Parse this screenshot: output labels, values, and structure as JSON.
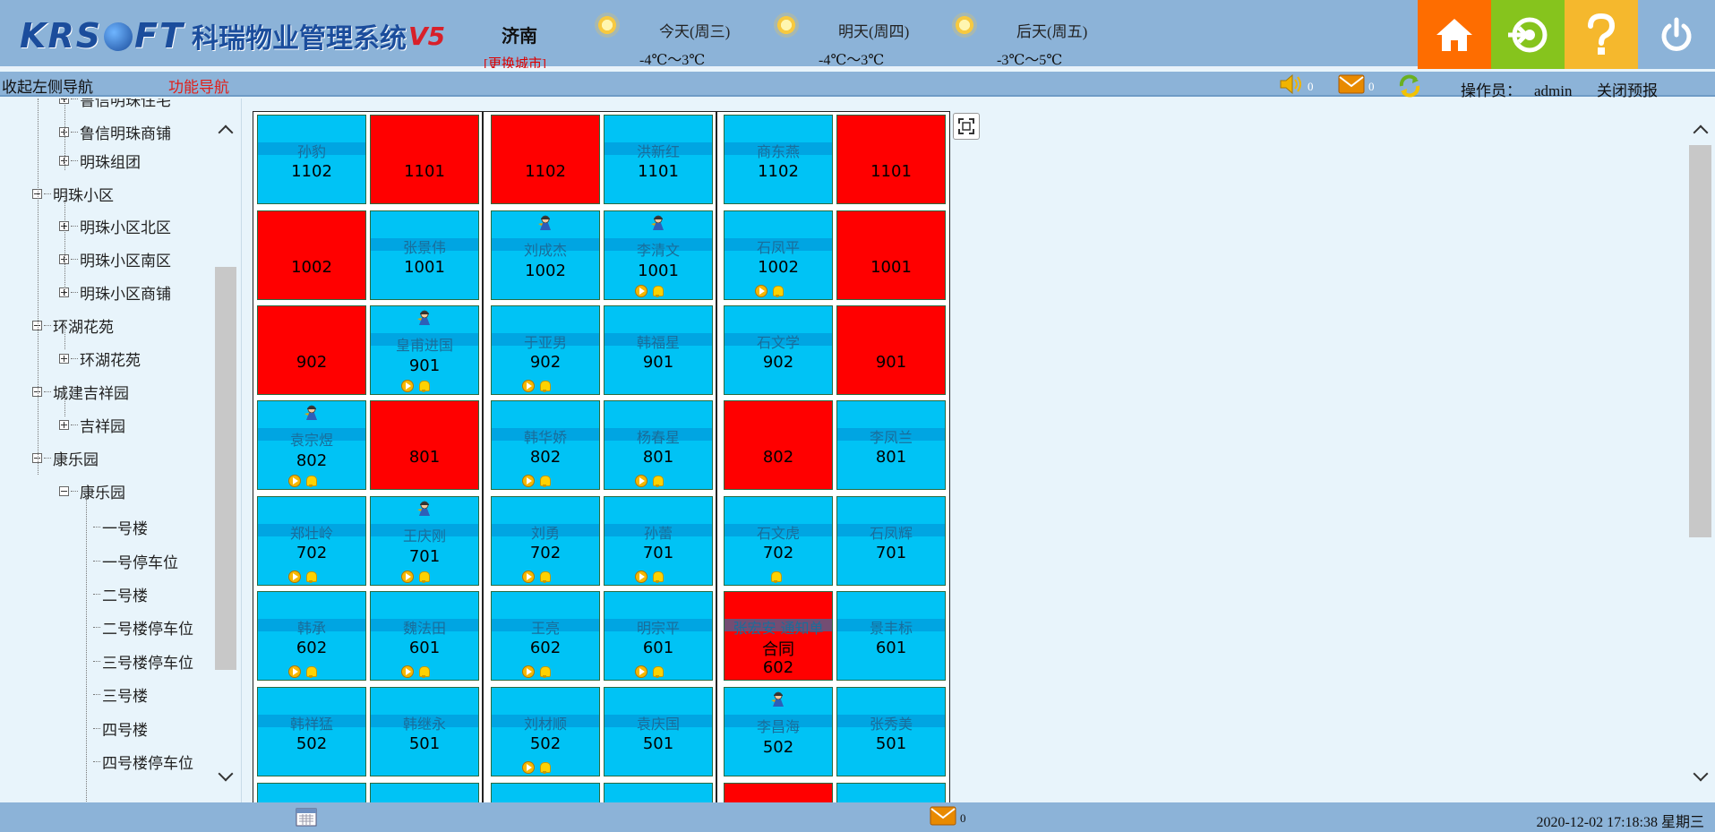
{
  "header": {
    "logo_brand_left": "KRS",
    "logo_brand_right": "FT",
    "system_name": "科瑞物业管理系统",
    "version": "V5",
    "city": "济南",
    "city_change": "[更换城市]",
    "weather": [
      {
        "day": "今天(周三)",
        "temp": "-4℃～3℃",
        "icon": "sunny-icon"
      },
      {
        "day": "明天(周四)",
        "temp": "-4℃～3℃",
        "icon": "sunny-icon"
      },
      {
        "day": "后天(周五)",
        "temp": "-3℃～5℃",
        "icon": "sunny-icon"
      }
    ],
    "buttons": {
      "home": {
        "icon": "home-icon",
        "color": "#fe6d00"
      },
      "refresh": {
        "icon": "login-icon",
        "color": "#86c41d"
      },
      "help": {
        "icon": "help-icon",
        "color": "#f5b82d"
      },
      "power": {
        "icon": "power-icon"
      }
    }
  },
  "navbar": {
    "collapse_label": "收起左侧导航",
    "function_nav_label": "功能导航",
    "sound_count": "0",
    "message_count": "0",
    "operator_label": "操作员：",
    "operator_name": "admin",
    "close_alert_label": "关闭预报"
  },
  "tree": [
    {
      "label": "鲁信明珠住宅",
      "level": 2,
      "toggle": "plus"
    },
    {
      "label": "鲁信明珠商铺",
      "level": 2,
      "toggle": "plus"
    },
    {
      "label": "明珠组团",
      "level": 2,
      "toggle": "plus"
    },
    {
      "label": "明珠小区",
      "level": 1,
      "toggle": "minus"
    },
    {
      "label": "明珠小区北区",
      "level": 2,
      "toggle": "plus"
    },
    {
      "label": "明珠小区南区",
      "level": 2,
      "toggle": "plus"
    },
    {
      "label": "明珠小区商铺",
      "level": 2,
      "toggle": "plus"
    },
    {
      "label": "环湖花苑",
      "level": 1,
      "toggle": "minus"
    },
    {
      "label": "环湖花苑",
      "level": 2,
      "toggle": "plus"
    },
    {
      "label": "城建吉祥园",
      "level": 1,
      "toggle": "minus"
    },
    {
      "label": "吉祥园",
      "level": 2,
      "toggle": "plus"
    },
    {
      "label": "康乐园",
      "level": 1,
      "toggle": "minus"
    },
    {
      "label": "康乐园",
      "level": 2,
      "toggle": "minus"
    },
    {
      "label": "一号楼",
      "level": 3,
      "toggle": "none"
    },
    {
      "label": "一号停车位",
      "level": 3,
      "toggle": "none"
    },
    {
      "label": "二号楼",
      "level": 3,
      "toggle": "none"
    },
    {
      "label": "二号楼停车位",
      "level": 3,
      "toggle": "none"
    },
    {
      "label": "三号楼停车位",
      "level": 3,
      "toggle": "none"
    },
    {
      "label": "三号楼",
      "level": 3,
      "toggle": "none"
    },
    {
      "label": "四号楼",
      "level": 3,
      "toggle": "none"
    },
    {
      "label": "四号楼停车位",
      "level": 3,
      "toggle": "none"
    }
  ],
  "rooms": [
    [
      {
        "owner": "孙豹",
        "num": "1102",
        "status": "occupied",
        "figure": false,
        "icons": ""
      },
      {
        "owner": "",
        "num": "1101",
        "status": "vacant",
        "figure": false,
        "icons": ""
      },
      {
        "owner": "",
        "num": "1102",
        "status": "vacant",
        "figure": false,
        "icons": ""
      },
      {
        "owner": "洪新红",
        "num": "1101",
        "status": "occupied",
        "figure": false,
        "icons": ""
      },
      {
        "owner": "商东燕",
        "num": "1102",
        "status": "occupied",
        "figure": false,
        "icons": ""
      },
      {
        "owner": "",
        "num": "1101",
        "status": "vacant",
        "figure": false,
        "icons": ""
      }
    ],
    [
      {
        "owner": "",
        "num": "1002",
        "status": "vacant",
        "figure": false,
        "icons": ""
      },
      {
        "owner": "张景伟",
        "num": "1001",
        "status": "occupied",
        "figure": false,
        "icons": ""
      },
      {
        "owner": "刘成杰",
        "num": "1002",
        "status": "occupied",
        "figure": true,
        "icons": ""
      },
      {
        "owner": "李清文",
        "num": "1001",
        "status": "occupied",
        "figure": true,
        "icons": "pb"
      },
      {
        "owner": "石凤平",
        "num": "1002",
        "status": "occupied",
        "figure": false,
        "icons": "pb"
      },
      {
        "owner": "",
        "num": "1001",
        "status": "vacant",
        "figure": false,
        "icons": ""
      }
    ],
    [
      {
        "owner": "",
        "num": "902",
        "status": "vacant",
        "figure": false,
        "icons": ""
      },
      {
        "owner": "皇甫进国",
        "num": "901",
        "status": "occupied",
        "figure": true,
        "icons": "pb"
      },
      {
        "owner": "于亚男",
        "num": "902",
        "status": "occupied",
        "figure": false,
        "icons": "pb"
      },
      {
        "owner": "韩福星",
        "num": "901",
        "status": "occupied",
        "figure": false,
        "icons": ""
      },
      {
        "owner": "石文学",
        "num": "902",
        "status": "occupied",
        "figure": false,
        "icons": ""
      },
      {
        "owner": "",
        "num": "901",
        "status": "vacant",
        "figure": false,
        "icons": ""
      }
    ],
    [
      {
        "owner": "袁宗煜",
        "num": "802",
        "status": "occupied",
        "figure": true,
        "icons": "pb"
      },
      {
        "owner": "",
        "num": "801",
        "status": "vacant",
        "figure": false,
        "icons": ""
      },
      {
        "owner": "韩华娇",
        "num": "802",
        "status": "occupied",
        "figure": false,
        "icons": "pb"
      },
      {
        "owner": "杨春星",
        "num": "801",
        "status": "occupied",
        "figure": false,
        "icons": "pb"
      },
      {
        "owner": "",
        "num": "802",
        "status": "vacant",
        "figure": false,
        "icons": ""
      },
      {
        "owner": "李凤兰",
        "num": "801",
        "status": "occupied",
        "figure": false,
        "icons": ""
      }
    ],
    [
      {
        "owner": "郑壮岭",
        "num": "702",
        "status": "occupied",
        "figure": false,
        "icons": "pb"
      },
      {
        "owner": "王庆刚",
        "num": "701",
        "status": "occupied",
        "figure": true,
        "icons": "pb"
      },
      {
        "owner": "刘勇",
        "num": "702",
        "status": "occupied",
        "figure": false,
        "icons": "pb"
      },
      {
        "owner": "孙蕾",
        "num": "701",
        "status": "occupied",
        "figure": false,
        "icons": "pb"
      },
      {
        "owner": "石文虎",
        "num": "702",
        "status": "occupied",
        "figure": false,
        "icons": "b"
      },
      {
        "owner": "石凤辉",
        "num": "701",
        "status": "occupied",
        "figure": false,
        "icons": ""
      }
    ],
    [
      {
        "owner": "韩承",
        "num": "602",
        "status": "occupied",
        "figure": false,
        "icons": "pb"
      },
      {
        "owner": "魏法田",
        "num": "601",
        "status": "occupied",
        "figure": false,
        "icons": "pb"
      },
      {
        "owner": "王亮",
        "num": "602",
        "status": "occupied",
        "figure": false,
        "icons": "pb"
      },
      {
        "owner": "明宗平",
        "num": "601",
        "status": "occupied",
        "figure": false,
        "icons": "pb"
      },
      {
        "owner": "张宏安 通知单",
        "sub": "合同",
        "num": "602",
        "status": "vacant",
        "figure": false,
        "icons": ""
      },
      {
        "owner": "景丰标",
        "num": "601",
        "status": "occupied",
        "figure": false,
        "icons": ""
      }
    ],
    [
      {
        "owner": "韩祥猛",
        "num": "502",
        "status": "occupied",
        "figure": false,
        "icons": ""
      },
      {
        "owner": "韩继永",
        "num": "501",
        "status": "occupied",
        "figure": false,
        "icons": ""
      },
      {
        "owner": "刘材顺",
        "num": "502",
        "status": "occupied",
        "figure": false,
        "icons": "pb"
      },
      {
        "owner": "袁庆国",
        "num": "501",
        "status": "occupied",
        "figure": false,
        "icons": ""
      },
      {
        "owner": "李昌海",
        "num": "502",
        "status": "occupied",
        "figure": true,
        "icons": ""
      },
      {
        "owner": "张秀美",
        "num": "501",
        "status": "occupied",
        "figure": false,
        "icons": ""
      }
    ],
    [
      {
        "owner": "",
        "num": "",
        "status": "occupied",
        "figure": false,
        "icons": ""
      },
      {
        "owner": "",
        "num": "",
        "status": "occupied",
        "figure": false,
        "icons": ""
      },
      {
        "owner": "",
        "num": "",
        "status": "occupied",
        "figure": false,
        "icons": ""
      },
      {
        "owner": "",
        "num": "",
        "status": "occupied",
        "figure": false,
        "icons": ""
      },
      {
        "owner": "",
        "num": "",
        "status": "vacant",
        "figure": false,
        "icons": ""
      },
      {
        "owner": "",
        "num": "",
        "status": "occupied",
        "figure": false,
        "icons": ""
      }
    ]
  ],
  "colors": {
    "occupied": "#00c3f5",
    "vacant": "#ff0000",
    "header_bg": "#8cb3d8"
  },
  "footer": {
    "mail_count": "0",
    "datetime": "2020-12-02 17:18:38 星期三"
  }
}
